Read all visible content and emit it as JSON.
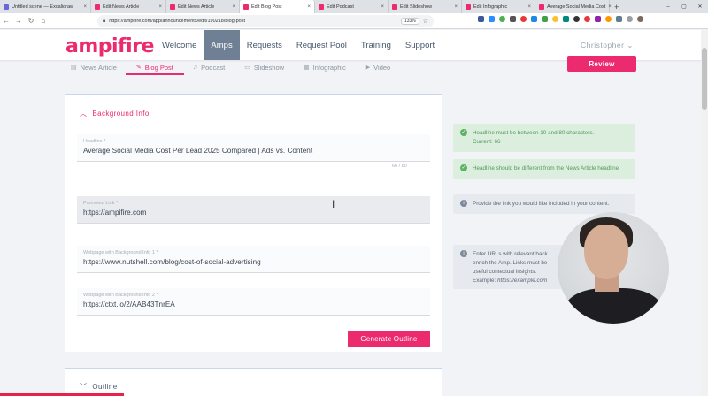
{
  "browser": {
    "tabs": [
      {
        "label": "Untitled scene — Excalidraw",
        "color": "#6965db",
        "active": false
      },
      {
        "label": "Edit News Article",
        "color": "#ec2a6e",
        "active": false
      },
      {
        "label": "Edit News Article",
        "color": "#ec2a6e",
        "active": false
      },
      {
        "label": "Edit Blog Post",
        "color": "#ec2a6e",
        "active": true
      },
      {
        "label": "Edit Podcast",
        "color": "#ec2a6e",
        "active": false
      },
      {
        "label": "Edit Slideshow",
        "color": "#ec2a6e",
        "active": false
      },
      {
        "label": "Edit Infographic",
        "color": "#ec2a6e",
        "active": false
      },
      {
        "label": "Average Social Media Cost",
        "color": "#ec2a6e",
        "active": false
      }
    ],
    "url": "https://ampifire.com/app/announcements/edit/190218/blog-post",
    "zoom": "133%"
  },
  "header": {
    "logo": "ampifire",
    "nav": [
      {
        "label": "Welcome",
        "active": false
      },
      {
        "label": "Amps",
        "active": true
      },
      {
        "label": "Requests",
        "active": false
      },
      {
        "label": "Request Pool",
        "active": false
      },
      {
        "label": "Training",
        "active": false
      },
      {
        "label": "Support",
        "active": false
      }
    ],
    "user": "Christopher"
  },
  "subtabs": [
    {
      "label": "News Article",
      "icon": "▤",
      "active": false
    },
    {
      "label": "Blog Post",
      "icon": "✎",
      "active": true
    },
    {
      "label": "Podcast",
      "icon": "♫",
      "active": false
    },
    {
      "label": "Slideshow",
      "icon": "▭",
      "active": false
    },
    {
      "label": "Infographic",
      "icon": "▦",
      "active": false
    },
    {
      "label": "Video",
      "icon": "▶",
      "active": false
    }
  ],
  "review_label": "Review",
  "form": {
    "section_title": "Background Info",
    "headline": {
      "label": "Headline *",
      "value": "Average Social Media Cost Per Lead 2025 Compared | Ads vs. Content",
      "counter": "66 / 80"
    },
    "promoted_link": {
      "label": "Promoted Link *",
      "value": "https://ampifire.com"
    },
    "webpage1": {
      "label": "Webpage with Background Info 1 *",
      "value": "https://www.nutshell.com/blog/cost-of-social-advertising"
    },
    "webpage2": {
      "label": "Webpage with Background Info 2 *",
      "value": "https://ctxt.io/2/AAB43TnrEA"
    },
    "generate_label": "Generate Outline"
  },
  "outline": {
    "title": "Outline"
  },
  "hints": {
    "h1": {
      "line1": "Headline must be between 10 and 80 characters.",
      "line2": "Current: 66"
    },
    "h2": {
      "text": "Headline should be different from the News Article headline"
    },
    "h3": {
      "text": "Provide the link you would like included in your content."
    },
    "h4": {
      "line1": "Enter URLs with relevant back",
      "line2": "enrich the Amp. Links must be",
      "line3": "useful contextual insights.",
      "example_label": "Example: ",
      "example": "https://example.com"
    }
  },
  "colors": {
    "brand": "#ec2a6e",
    "success": "#5cb267",
    "nav_active": "#6f7f94"
  }
}
